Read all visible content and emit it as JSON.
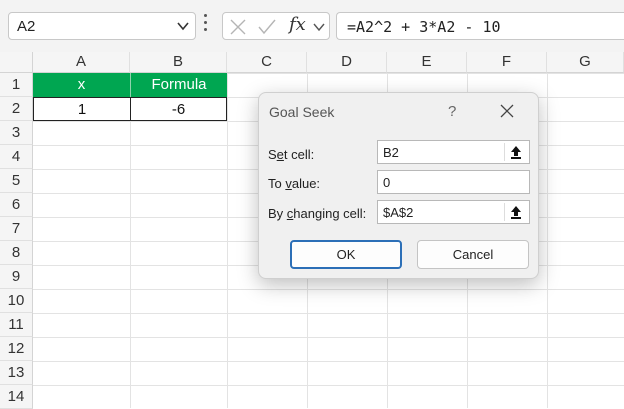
{
  "formula_bar": {
    "name_box": "A2",
    "fx_label": "fx",
    "formula": "=A2^2 + 3*A2 - 10"
  },
  "sheet": {
    "columns": [
      "A",
      "B",
      "C",
      "D",
      "E",
      "F",
      "G"
    ],
    "rows": [
      "1",
      "2",
      "3",
      "4",
      "5",
      "6",
      "7",
      "8",
      "9",
      "10",
      "11",
      "12",
      "13",
      "14"
    ],
    "cells": {
      "A1": "x",
      "B1": "Formula",
      "A2": "1",
      "B2": "-6"
    },
    "colors": {
      "header_fill": "#00a651",
      "header_text": "#ffffff"
    }
  },
  "dialog": {
    "title": "Goal Seek",
    "help": "?",
    "set_cell": {
      "label_pre": "S",
      "label_u": "e",
      "label_post": "t cell:",
      "value": "B2"
    },
    "to_value": {
      "label_pre": "To ",
      "label_u": "v",
      "label_post": "alue:",
      "value": "0"
    },
    "by_changing": {
      "label_pre": "By ",
      "label_u": "c",
      "label_post": "hanging cell:",
      "value": "$A$2"
    },
    "ok_label": "OK",
    "cancel_label": "Cancel",
    "accent": "#2c6fb7"
  }
}
